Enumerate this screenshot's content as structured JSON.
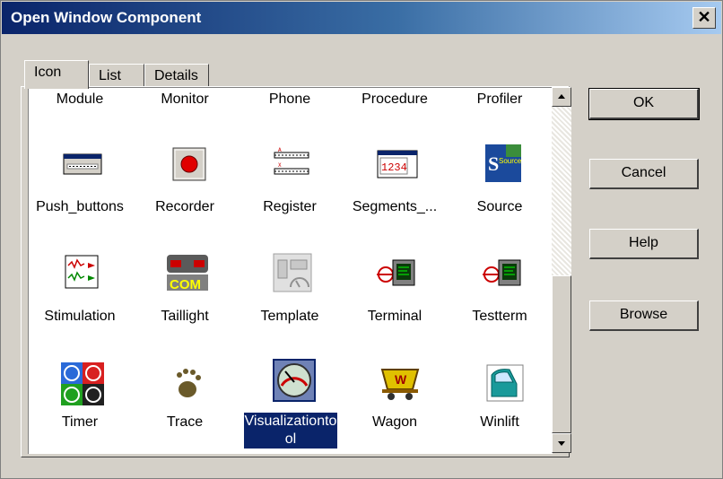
{
  "window": {
    "title": "Open Window Component",
    "close_label": "✕"
  },
  "tabs": [
    {
      "label": "Icon"
    },
    {
      "label": "List"
    },
    {
      "label": "Details"
    }
  ],
  "items": [
    {
      "label": "Module",
      "icon": "module-icon"
    },
    {
      "label": "Monitor",
      "icon": "monitor-icon"
    },
    {
      "label": "Phone",
      "icon": "phone-icon"
    },
    {
      "label": "Procedure",
      "icon": "procedure-icon"
    },
    {
      "label": "Profiler",
      "icon": "profiler-icon"
    },
    {
      "label": "Push_buttons",
      "icon": "push-buttons-icon"
    },
    {
      "label": "Recorder",
      "icon": "recorder-icon"
    },
    {
      "label": "Register",
      "icon": "register-icon"
    },
    {
      "label": "Segments_...",
      "icon": "segments-icon"
    },
    {
      "label": "Source",
      "icon": "source-icon"
    },
    {
      "label": "Stimulation",
      "icon": "stimulation-icon"
    },
    {
      "label": "Taillight",
      "icon": "taillight-icon"
    },
    {
      "label": "Template",
      "icon": "template-icon"
    },
    {
      "label": "Terminal",
      "icon": "terminal-icon"
    },
    {
      "label": "Testterm",
      "icon": "testterm-icon"
    },
    {
      "label": "Timer",
      "icon": "timer-icon"
    },
    {
      "label": "Trace",
      "icon": "trace-icon"
    },
    {
      "label": "Visualizationtool",
      "display": "Visualizationto ol",
      "icon": "visualization-tool-icon",
      "selected": true
    },
    {
      "label": "Wagon",
      "icon": "wagon-icon"
    },
    {
      "label": "Winlift",
      "icon": "winlift-icon"
    }
  ],
  "icon_text": {
    "segments": "1234",
    "source": "Source",
    "taillight": "COM",
    "wagon": "W"
  },
  "buttons": {
    "ok": "OK",
    "cancel": "Cancel",
    "help": "Help",
    "browse": "Browse"
  },
  "colors": {
    "title_start": "#0a246a",
    "title_end": "#a6caf0",
    "face": "#d4d0c8",
    "selection": "#0a246a"
  }
}
